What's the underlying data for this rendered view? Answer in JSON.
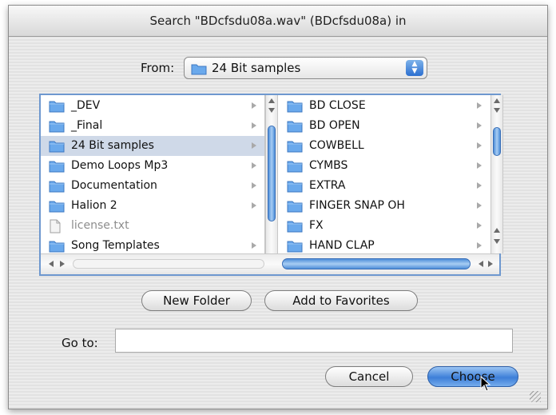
{
  "dialog": {
    "title": "Search \"BDcfsdu08a.wav\" (BDcfsdu08a) in"
  },
  "from": {
    "label": "From:",
    "selected": "24 Bit samples"
  },
  "browser": {
    "column1": [
      {
        "name": "_DEV",
        "type": "folder"
      },
      {
        "name": "_Final",
        "type": "folder"
      },
      {
        "name": "24 Bit samples",
        "type": "folder",
        "selected": true
      },
      {
        "name": "Demo Loops Mp3",
        "type": "folder"
      },
      {
        "name": "Documentation",
        "type": "folder"
      },
      {
        "name": "Halion 2",
        "type": "folder"
      },
      {
        "name": "license.txt",
        "type": "file"
      },
      {
        "name": "Song Templates",
        "type": "folder"
      }
    ],
    "column2": [
      {
        "name": "BD CLOSE",
        "type": "folder"
      },
      {
        "name": "BD OPEN",
        "type": "folder"
      },
      {
        "name": "COWBELL",
        "type": "folder"
      },
      {
        "name": "CYMBS",
        "type": "folder"
      },
      {
        "name": "EXTRA",
        "type": "folder"
      },
      {
        "name": "FINGER SNAP OH",
        "type": "folder"
      },
      {
        "name": "FX",
        "type": "folder"
      },
      {
        "name": "HAND CLAP",
        "type": "folder"
      }
    ]
  },
  "buttons": {
    "new_folder": "New Folder",
    "add_favorites": "Add to Favorites",
    "cancel": "Cancel",
    "choose": "Choose"
  },
  "goto": {
    "label": "Go to:",
    "value": ""
  },
  "colors": {
    "selection": "#cfd9e8",
    "accent": "#3d7fd8",
    "folder": "#6aa9ec"
  }
}
